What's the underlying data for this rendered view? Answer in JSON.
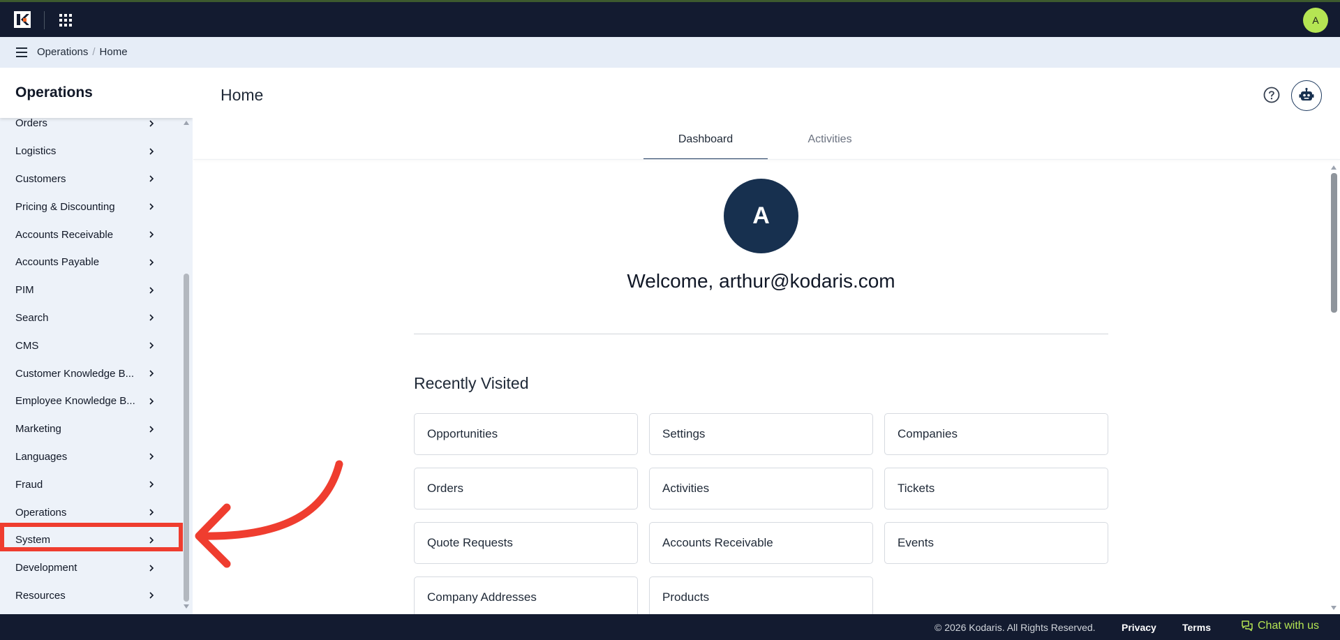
{
  "topbar": {
    "user_initial": "A",
    "colors": {
      "background": "#131b30",
      "avatar": "#b5e553"
    }
  },
  "breadcrumb": {
    "items": [
      "Operations",
      "Home"
    ],
    "separator": "/"
  },
  "sidebar": {
    "title": "Operations",
    "items": [
      {
        "label": "Orders"
      },
      {
        "label": "Logistics"
      },
      {
        "label": "Customers"
      },
      {
        "label": "Pricing & Discounting"
      },
      {
        "label": "Accounts Receivable"
      },
      {
        "label": "Accounts Payable"
      },
      {
        "label": "PIM"
      },
      {
        "label": "Search"
      },
      {
        "label": "CMS"
      },
      {
        "label": "Customer Knowledge B..."
      },
      {
        "label": "Employee Knowledge B..."
      },
      {
        "label": "Marketing"
      },
      {
        "label": "Languages"
      },
      {
        "label": "Fraud"
      },
      {
        "label": "Operations"
      },
      {
        "label": "System"
      },
      {
        "label": "Development"
      },
      {
        "label": "Resources"
      }
    ],
    "highlighted_item": "System",
    "highlight_color": "#ef3d2f"
  },
  "main": {
    "page_title": "Home",
    "tabs": [
      {
        "label": "Dashboard",
        "active": true
      },
      {
        "label": "Activities",
        "active": false
      }
    ],
    "avatar_initial": "A",
    "welcome": "Welcome, arthur@kodaris.com",
    "recently_visited_title": "Recently Visited",
    "recent": [
      "Opportunities",
      "Settings",
      "Companies",
      "Orders",
      "Activities",
      "Tickets",
      "Quote Requests",
      "Accounts Receivable",
      "Events",
      "Company Addresses",
      "Products"
    ]
  },
  "footer": {
    "copyright": "© 2026 Kodaris. All Rights Reserved.",
    "privacy": "Privacy",
    "terms": "Terms",
    "chat": "Chat with us",
    "chat_color": "#b5e553"
  }
}
